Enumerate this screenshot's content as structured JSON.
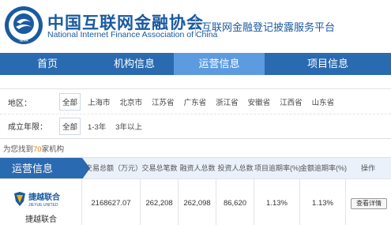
{
  "header": {
    "org_name_cn": "中国互联网金融协会",
    "org_name_en": "National Internet Finance Association of China",
    "platform_title": "互联网金融登记披露服务平台",
    "logo_text": "NIFA"
  },
  "nav": {
    "items": [
      {
        "label": "首页",
        "active": false
      },
      {
        "label": "机构信息",
        "active": false
      },
      {
        "label": "运营信息",
        "active": true
      },
      {
        "label": "项目信息",
        "active": false
      }
    ]
  },
  "filters": {
    "region": {
      "label": "地区：",
      "options": [
        "全部",
        "上海市",
        "北京市",
        "江苏省",
        "广东省",
        "浙江省",
        "安徽省",
        "江西省",
        "山东省"
      ],
      "selected": "全部"
    },
    "age": {
      "label": "成立年限：",
      "options": [
        "全部",
        "1-3年",
        "3年以上"
      ],
      "selected": "全部"
    }
  },
  "result": {
    "prefix": "为您找到",
    "count": "70",
    "suffix": "家机构"
  },
  "table": {
    "section_title": "运营信息",
    "columns": [
      "交易总额（万元）",
      "交易总笔数",
      "融资人总数",
      "投资人总数",
      "项目逾期率(%)",
      "金额逾期率(%)",
      "操作"
    ],
    "rows": [
      {
        "platform_name": "捷越联合",
        "logo_cn": "捷越联合",
        "logo_en": "JIEYUE UNITED",
        "total_amount": "2168627.07",
        "total_transactions": "262,208",
        "total_borrowers": "262,098",
        "total_investors": "86,620",
        "project_overdue_rate": "1.13%",
        "amount_overdue_rate": "1.13%",
        "action_label": "查看详情"
      }
    ]
  },
  "colors": {
    "primary": "#2a6ab0",
    "nav_active": "#5c9be0",
    "highlight": "#e07a00"
  }
}
